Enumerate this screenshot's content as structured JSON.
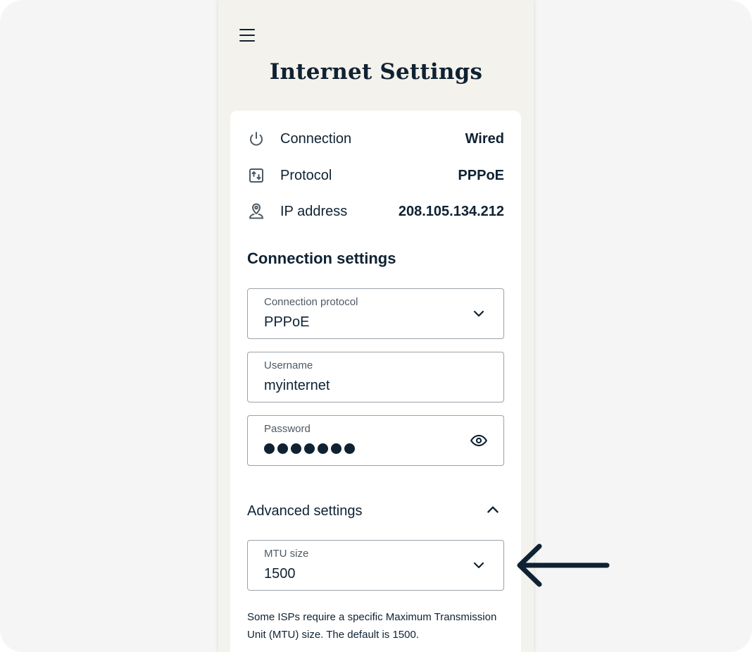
{
  "header": {
    "title": "Internet Settings",
    "menu_icon": "hamburger-menu-icon"
  },
  "status": [
    {
      "icon": "power-icon",
      "label": "Connection",
      "value": "Wired"
    },
    {
      "icon": "protocol-icon",
      "label": "Protocol",
      "value": "PPPoE"
    },
    {
      "icon": "location-person-icon",
      "label": "IP address",
      "value": "208.105.134.212"
    }
  ],
  "connection_settings": {
    "title": "Connection settings",
    "protocol": {
      "label": "Connection protocol",
      "value": "PPPoE",
      "icon": "chevron-down-icon"
    },
    "username": {
      "label": "Username",
      "value": "myinternet"
    },
    "password": {
      "label": "Password",
      "masked_length": 7,
      "icon": "eye-icon"
    }
  },
  "advanced": {
    "label": "Advanced settings",
    "icon": "chevron-up-icon",
    "expanded": true,
    "mtu": {
      "label": "MTU size",
      "value": "1500",
      "icon": "chevron-down-icon"
    },
    "helper": "Some ISPs require a specific Maximum Transmission Unit (MTU) size. The default is 1500."
  },
  "annotation": {
    "icon": "arrow-left-icon",
    "color": "#0f2233"
  },
  "colors": {
    "text": "#0f2233",
    "phone_bg": "#f4f2ec",
    "card_bg": "#ffffff",
    "border": "#9aa2a9"
  }
}
